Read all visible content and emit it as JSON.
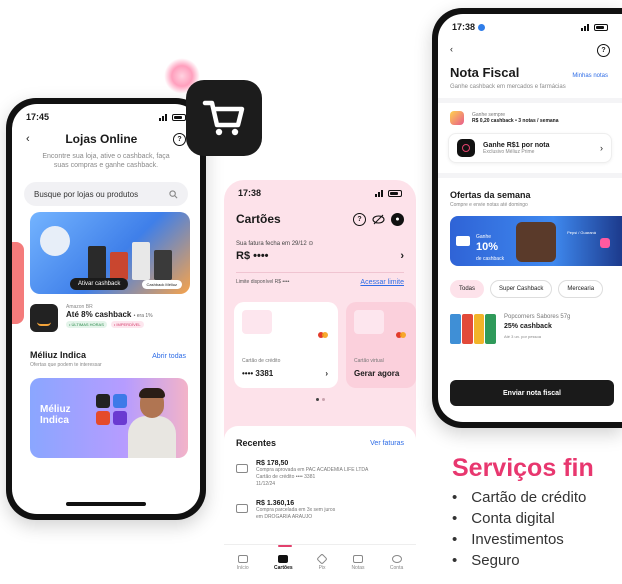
{
  "phone_lojas": {
    "time": "17:45",
    "title": "Lojas Online",
    "subtitle": "Encontre sua loja, ative o cashback, faça suas compras e ganhe cashback.",
    "search_placeholder": "Busque por lojas ou produtos",
    "banner_cta": "Ativar cashback",
    "banner_tag": "Cashback Méliuz",
    "store": {
      "name": "Amazon BR",
      "cashback": "Até 8% cashback",
      "cashback_prev": "• era 1%",
      "tag1": "• ÚLTIMAS HORAS",
      "tag2": "• IMPERDÍVEL"
    },
    "section_title": "Méliuz Indica",
    "section_link": "Abrir todas",
    "section_sub": "Ofertas que podem te interessar",
    "indica_line1": "Méliuz",
    "indica_line2": "Indica"
  },
  "phone_cartoes": {
    "time": "17:38",
    "title": "Cartões",
    "fatura_label": "Sua fatura fecha em 29/12 ⊙",
    "fatura_value": "R$ ••••",
    "limit_label": "Limite disponível R$ ••••",
    "limit_link": "Acessar limite",
    "card1_label": "Cartão de crédito",
    "card1_number": "•••• 3381",
    "card2_label": "Cartão virtual",
    "card2_action": "Gerar agora",
    "recent_title": "Recentes",
    "recent_link": "Ver faturas",
    "transactions": [
      {
        "amount": "R$ 178,50",
        "desc1": "Compra aprovada em PAC ACADEMIA LIFE LTDA",
        "desc2": "Cartão de crédito •••• 3381",
        "desc3": "11/12/24"
      },
      {
        "amount": "R$ 1.360,16",
        "desc1": "Compra parcelada em 3x sem juros",
        "desc2": "em DROGARIA ARAUJO",
        "desc3": ""
      }
    ],
    "tabs": [
      {
        "label": "Início"
      },
      {
        "label": "Cartões"
      },
      {
        "label": "Pix"
      },
      {
        "label": "Notas"
      },
      {
        "label": "Conta"
      }
    ]
  },
  "phone_nota": {
    "time": "17:38",
    "title": "Nota Fiscal",
    "title_link": "Minhas notas",
    "subtitle": "Ganhe cashback em mercados e farmácias",
    "info_line1": "Ganhe sempre",
    "info_line2": "R$ 0,20 cashback • 3 notas / semana",
    "promo_title": "Ganhe R$1 por nota",
    "promo_sub": "Exclusivo Méliuz Prime",
    "offers_title": "Ofertas da semana",
    "offers_sub": "Compre e envie notas até domingo",
    "banner_prefix": "Ganhe",
    "banner_pct": "10%",
    "banner_suffix": "de cashback",
    "banner_copy": "Pepsi / Guaraná",
    "chips": [
      "Todas",
      "Super Cashback",
      "Mercearia"
    ],
    "product_name": "Popcorners Sabores 57g",
    "product_cashback": "25% cashback",
    "product_limit": "Até 3 un. por pessoa",
    "cta": "Enviar nota fiscal"
  },
  "services": {
    "title": "Serviços fin",
    "items": [
      "Cartão de crédito",
      "Conta digital",
      "Investimentos",
      "Seguro"
    ]
  }
}
